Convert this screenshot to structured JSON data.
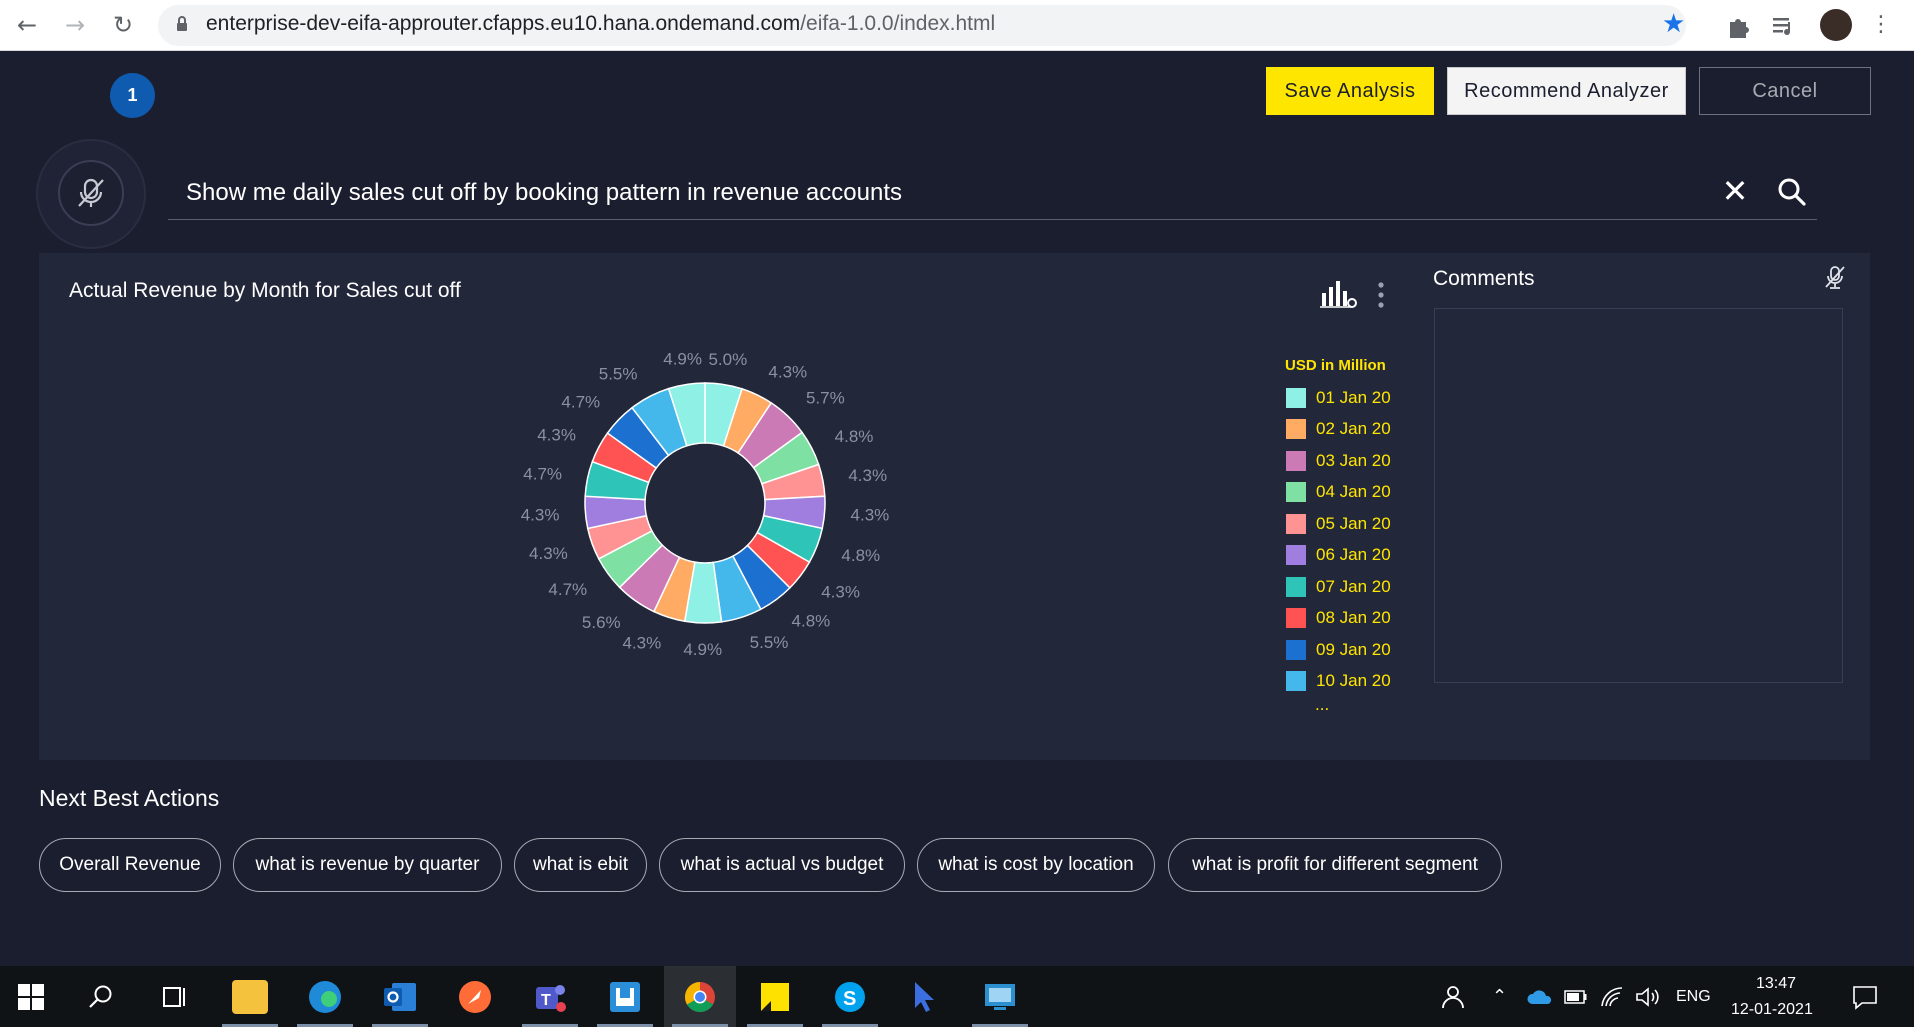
{
  "browser": {
    "url_host": "enterprise-dev-eifa-approuter.cfapps.eu10.hana.ondemand.com",
    "url_path": "/eifa-1.0.0/index.html"
  },
  "header": {
    "step_number": "1",
    "save_label": "Save Analysis",
    "recommend_label": "Recommend Analyzer",
    "cancel_label": "Cancel"
  },
  "search": {
    "query": "Show me daily sales cut off by booking pattern in revenue accounts"
  },
  "chart_panel": {
    "title": "Actual Revenue by Month for Sales cut off"
  },
  "chart_data": {
    "type": "pie",
    "donut": true,
    "legend_title": "USD in Million",
    "legend_placement": "right",
    "visible_legend_entries": [
      "01 Jan 20",
      "02 Jan 20",
      "03 Jan 20",
      "04 Jan 20",
      "05 Jan 20",
      "06 Jan 20",
      "07 Jan 20",
      "08 Jan 20",
      "09 Jan 20",
      "10 Jan 20"
    ],
    "legend_more": "...",
    "colors": [
      "#8ff0e6",
      "#ffab63",
      "#cc7ab5",
      "#7fe0a3",
      "#ff9393",
      "#a07ee0",
      "#2fc4b8",
      "#ff5252",
      "#1c70d0",
      "#44b8ea"
    ],
    "slice_labels": [
      "5.0%",
      "4.3%",
      "5.7%",
      "4.8%",
      "4.3%",
      "4.3%",
      "4.8%",
      "4.3%",
      "4.8%",
      "5.5%",
      "4.9%",
      "4.3%",
      "5.6%",
      "4.7%",
      "4.3%",
      "4.3%",
      "4.7%",
      "4.3%",
      "4.7%",
      "5.5%",
      "4.9%"
    ]
  },
  "comments": {
    "title": "Comments"
  },
  "next_best_actions": {
    "title": "Next Best Actions",
    "items": [
      "Overall Revenue",
      "what is revenue by quarter",
      "what is ebit",
      "what is actual vs budget",
      "what is cost by location",
      "what is profit for different segment"
    ]
  },
  "taskbar": {
    "language": "ENG",
    "time": "13:47",
    "date": "12-01-2021"
  }
}
